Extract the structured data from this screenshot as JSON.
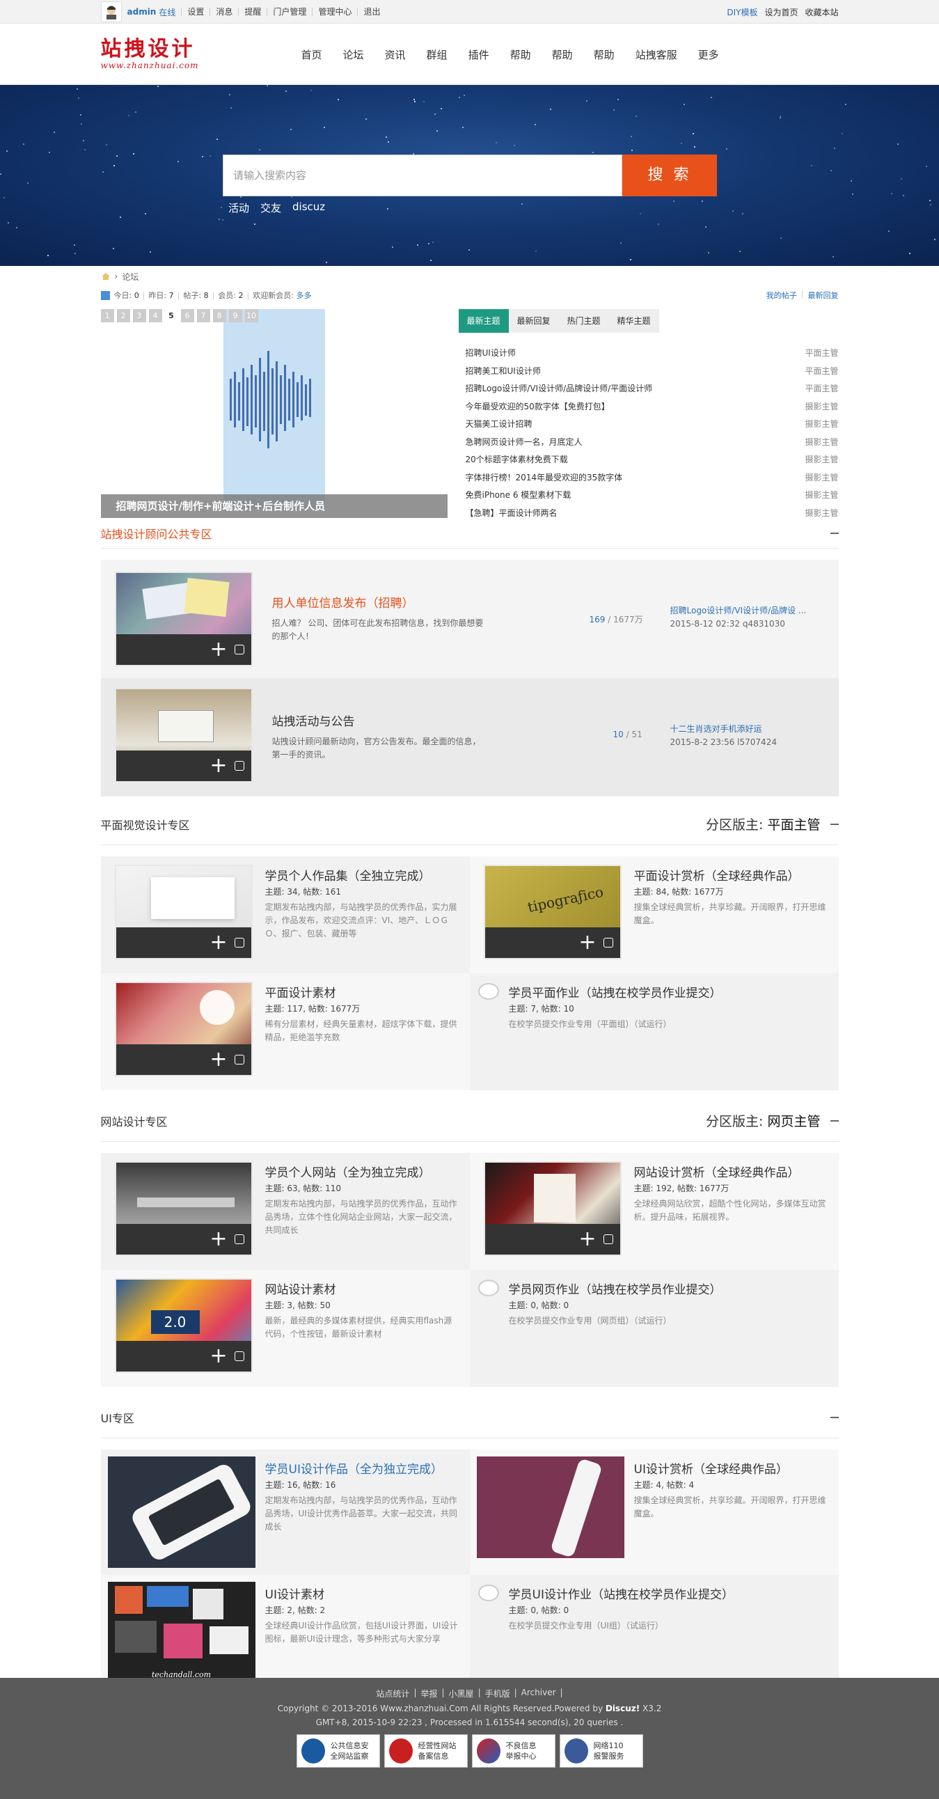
{
  "topbar": {
    "user": "admin",
    "status": "在线",
    "links": [
      "设置",
      "消息",
      "提醒",
      "门户管理",
      "管理中心",
      "退出"
    ],
    "right": [
      "DIY模板",
      "设为首页",
      "收藏本站"
    ]
  },
  "header": {
    "logo_cn": "站拽设计",
    "logo_en": "www.zhanzhuai.com",
    "nav": [
      "首页",
      "论坛",
      "资讯",
      "群组",
      "插件",
      "帮助",
      "帮助",
      "帮助",
      "站拽客服",
      "更多"
    ]
  },
  "banner": {
    "placeholder": "请输入搜索内容",
    "button": "搜 索",
    "hot": [
      "活动",
      "交友",
      "discuz"
    ]
  },
  "breadcrumb": {
    "current": "论坛"
  },
  "stats": {
    "today_label": "今日:",
    "today": "0",
    "yest_label": "昨日:",
    "yest": "7",
    "posts_label": "帖子:",
    "posts": "8",
    "members_label": "会员:",
    "members": "2",
    "new_label": "欢迎新会员:",
    "new_member": "多多",
    "my_posts": "我的帖子",
    "latest_reply": "最新回复"
  },
  "slider": {
    "pages": [
      "1",
      "2",
      "3",
      "4",
      "5",
      "6",
      "7",
      "8",
      "9",
      "10"
    ],
    "active": 5,
    "caption": "招聘网页设计/制作+前端设计+后台制作人员"
  },
  "tabs": [
    "最新主题",
    "最新回复",
    "热门主题",
    "精华主题"
  ],
  "topics": [
    {
      "t": "招聘UI设计师",
      "a": "平面主管"
    },
    {
      "t": "招聘美工和UI设计师",
      "a": "平面主管"
    },
    {
      "t": "招聘Logo设计师/VI设计师/品牌设计师/平面设计师",
      "a": "平面主管"
    },
    {
      "t": "今年最受欢迎的50款字体【免费打包】",
      "a": "摄影主管"
    },
    {
      "t": "天猫美工设计招聘",
      "a": "摄影主管"
    },
    {
      "t": "急聘网页设计师一名，月底定人",
      "a": "摄影主管"
    },
    {
      "t": "20个标题字体素材免费下载",
      "a": "摄影主管"
    },
    {
      "t": "字体排行榜！2014年最受欢迎的35款字体",
      "a": "摄影主管"
    },
    {
      "t": "免费iPhone 6 模型素材下载",
      "a": "摄影主管"
    },
    {
      "t": "【急聘】平面设计师两名",
      "a": "摄影主管"
    }
  ],
  "s1": {
    "title": "站拽设计顾问公共专区",
    "forums": [
      {
        "title": "用人单位信息发布（招聘）",
        "desc1": "招人难？ 公司、团体可在此发布招聘信息，找到你最想要",
        "desc2": "的那个人！",
        "threads": "169",
        "posts": "1677万",
        "last_title": "招聘Logo设计师/VI设计师/品牌设 ...",
        "last_time": "2015-8-12 02:32 q4831030"
      },
      {
        "title": "站拽活动与公告",
        "desc1": "站拽设计顾问最新动向，官方公告发布。最全面的信息，",
        "desc2": "第一手的资讯。",
        "threads": "10",
        "posts": "51",
        "last_title": "十二生肖选对手机添好运",
        "last_time": "2015-8-2 23:56 l5707424"
      }
    ]
  },
  "s2": {
    "title": "平面视觉设计专区",
    "mod_label": "分区版主:",
    "mod": "平面主管",
    "cells": [
      {
        "title": "学员个人作品集（全独立完成）",
        "meta": "主题: 34, 帖数: 161",
        "desc": "定期发布站拽内部，与站拽学员的优秀作品，实力展示，作品发布，欢迎交流点评：VI、地产、ＬＯＧＯ、报广、包装、藏册等"
      },
      {
        "title": "平面设计赏析（全球经典作品）",
        "meta": "主题: 84, 帖数: 1677万",
        "desc": "搜集全球经典赏析，共享珍藏。开阔眼界，打开思维魔盒。"
      },
      {
        "title": "平面设计素材",
        "meta": "主题: 117, 帖数: 1677万",
        "desc": "稀有分层素材，经典矢量素材，超炫字体下载，提供精品，拒绝滥竽充数"
      },
      {
        "title": "学员平面作业（站拽在校学员作业提交）",
        "meta": "主题: 7, 帖数: 10",
        "desc": "在校学员提交作业专用（平面组）（试运行）"
      }
    ]
  },
  "s3": {
    "title": "网站设计专区",
    "mod_label": "分区版主:",
    "mod": "网页主管",
    "cells": [
      {
        "title": "学员个人网站（全为独立完成）",
        "meta": "主题: 63, 帖数: 110",
        "desc": "定期发布站拽内部，与站拽学员的优秀作品，互动作品秀场，立体个性化网站企业网站，大家一起交流，共同成长"
      },
      {
        "title": "网站设计赏析（全球经典作品）",
        "meta": "主题: 192, 帖数: 1677万",
        "desc": "全球经典网站欣赏，超酷个性化网站，多媒体互动赏析。提升品味，拓展视界。"
      },
      {
        "title": "网站设计素材",
        "meta": "主题: 3, 帖数: 50",
        "desc": "最新，最经典的多媒体素材提供，经典实用flash源代码，个性按钮，最新设计素材"
      },
      {
        "title": "学员网页作业（站拽在校学员作业提交）",
        "meta": "主题: 0, 帖数: 0",
        "desc": "在校学员提交作业专用（网页组）（试运行）"
      }
    ]
  },
  "s4": {
    "title": "UI专区",
    "cells": [
      {
        "title": "学员UI设计作品（全为独立完成）",
        "meta": "主题: 16, 帖数: 16",
        "desc": "定期发布站拽内部，与站拽学员的优秀作品，互动作品秀场，UI设计优秀作品荟萃。大家一起交流，共同成长"
      },
      {
        "title": "UI设计赏析（全球经典作品）",
        "meta": "主题: 4, 帖数: 4",
        "desc": "搜集全球经典赏析，共享珍藏。开阔眼界，打开思维魔盒。"
      },
      {
        "title": "UI设计素材",
        "meta": "主题: 2, 帖数: 2",
        "desc": "全球经典UI设计作品欣赏，包括UI设计界面，UI设计图标，最新UI设计理念，等多种形式与大家分享",
        "img_text": "techandall.com"
      },
      {
        "title": "学员UI设计作业（站拽在校学员作业提交）",
        "meta": "主题: 0, 帖数: 0",
        "desc": "在校学员提交作业专用（UI组）（试运行）"
      }
    ]
  },
  "footer": {
    "links": [
      "站点统计",
      "举报",
      "小黑屋",
      "手机版",
      "Archiver"
    ],
    "copyright_a": "Copyright  © 2013-2016 Www.zhanzhuai.Com All Rights Reserved.Powered by ",
    "copyright_b": "Discuz!",
    "copyright_c": " X3.2",
    "gmt": "GMT+8, 2015-10-9 22:23 , Processed in 1.615544 second(s), 20 queries .",
    "badges": [
      [
        "公共信息安",
        "全网站监察"
      ],
      [
        "经营性网站",
        "备案信息"
      ],
      [
        "不良信息",
        "举报中心"
      ],
      [
        "网络110",
        "报警服务"
      ]
    ]
  },
  "colors": {
    "accent": "#e5501c",
    "link": "#2b6fb6",
    "tab_active": "#1f9a82",
    "banner": "#143770"
  }
}
